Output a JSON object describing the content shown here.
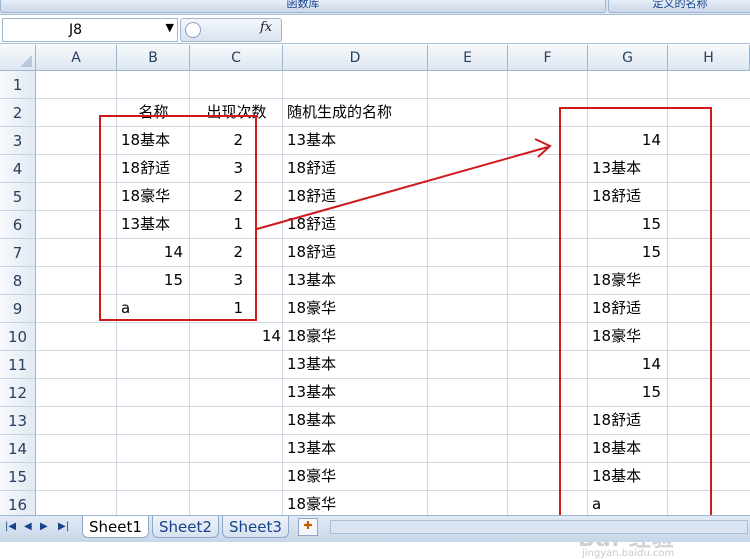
{
  "ribbon": {
    "groups": [
      "函数库",
      "定义的名称"
    ]
  },
  "formula_bar": {
    "name_box": "J8",
    "fx_label": "fx",
    "formula": ""
  },
  "columns": [
    "A",
    "B",
    "C",
    "D",
    "E",
    "F",
    "G",
    "H"
  ],
  "rows": [
    "1",
    "2",
    "3",
    "4",
    "5",
    "6",
    "7",
    "8",
    "9",
    "10",
    "11",
    "12",
    "13",
    "14",
    "15",
    "16"
  ],
  "headers": {
    "b2": "名称",
    "c2": "出现次数",
    "d2": "随机生成的名称"
  },
  "col_b": [
    "18基本",
    "18舒适",
    "18豪华",
    "13基本",
    "14",
    "15",
    "a"
  ],
  "col_c": [
    "2",
    "3",
    "2",
    "1",
    "2",
    "3",
    "1"
  ],
  "c10": "14",
  "col_d": [
    "13基本",
    "18舒适",
    "18舒适",
    "18舒适",
    "18舒适",
    "13基本",
    "18豪华",
    "18豪华",
    "13基本",
    "13基本",
    "18基本",
    "13基本",
    "18豪华",
    "18豪华"
  ],
  "col_g": [
    "14",
    "13基本",
    "18舒适",
    "15",
    "15",
    "18豪华",
    "18舒适",
    "18豪华",
    "14",
    "15",
    "18舒适",
    "18基本",
    "18基本",
    "a"
  ],
  "sheet_tabs": [
    "Sheet1",
    "Sheet2",
    "Sheet3"
  ],
  "watermark": {
    "brand": "Bai 经验",
    "url": "jingyan.baidu.com"
  },
  "colors": {
    "annotation_red": "#d0191b",
    "header_blue": "#dde6f1"
  }
}
